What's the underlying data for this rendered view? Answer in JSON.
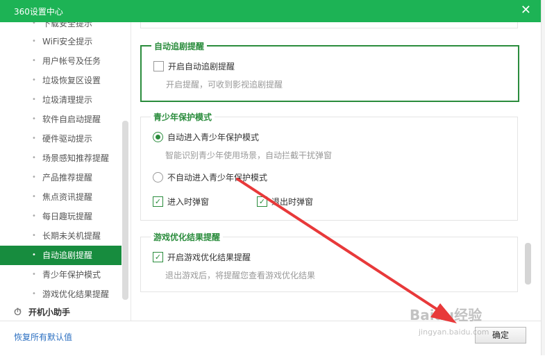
{
  "window": {
    "title": "360设置中心",
    "close_glyph": "✕"
  },
  "sidebar": {
    "items": [
      {
        "label": "下载安全提示",
        "active": false
      },
      {
        "label": "WiFi安全提示",
        "active": false
      },
      {
        "label": "用户帐号及任务",
        "active": false
      },
      {
        "label": "垃圾恢复区设置",
        "active": false
      },
      {
        "label": "垃圾清理提示",
        "active": false
      },
      {
        "label": "软件自启动提醒",
        "active": false
      },
      {
        "label": "硬件驱动提示",
        "active": false
      },
      {
        "label": "场景感知推荐提醒",
        "active": false
      },
      {
        "label": "产品推荐提醒",
        "active": false
      },
      {
        "label": "焦点资讯提醒",
        "active": false
      },
      {
        "label": "每日趣玩提醒",
        "active": false
      },
      {
        "label": "长期未关机提醒",
        "active": false
      },
      {
        "label": "自动追剧提醒",
        "active": true
      },
      {
        "label": "青少年保护模式",
        "active": false
      },
      {
        "label": "游戏优化结果提醒",
        "active": false
      }
    ],
    "group": {
      "label": "开机小助手",
      "icon": "timer-icon"
    }
  },
  "sections": {
    "auto_drama": {
      "title": "自动追剧提醒",
      "option_label": "开启自动追剧提醒",
      "option_checked": false,
      "description": "开启提醒，可收到影视追剧提醒"
    },
    "teen_mode": {
      "title": "青少年保护模式",
      "auto_enter": {
        "label": "自动进入青少年保护模式",
        "selected": true
      },
      "auto_desc": "智能识别青少年使用场景，自动拦截干扰弹窗",
      "no_auto": {
        "label": "不自动进入青少年保护模式",
        "selected": false
      },
      "enter_popup": {
        "label": "进入时弹窗",
        "checked": true
      },
      "exit_popup": {
        "label": "退出时弹窗",
        "checked": true
      }
    },
    "game_opt": {
      "title": "游戏优化结果提醒",
      "option_label": "开启游戏优化结果提醒",
      "option_checked": true,
      "description": "退出游戏后，将提醒您查看游戏优化结果"
    }
  },
  "footer": {
    "restore_label": "恢复所有默认值",
    "ok_label": "确定"
  },
  "watermark": {
    "text": "Baidu经验",
    "url": "jingyan.baidu.com"
  },
  "colors": {
    "brand": "#1db355",
    "accent": "#2a8c3c",
    "active_bg": "#178c3e",
    "link": "#2b6fc1",
    "arrow": "#e8393a"
  }
}
